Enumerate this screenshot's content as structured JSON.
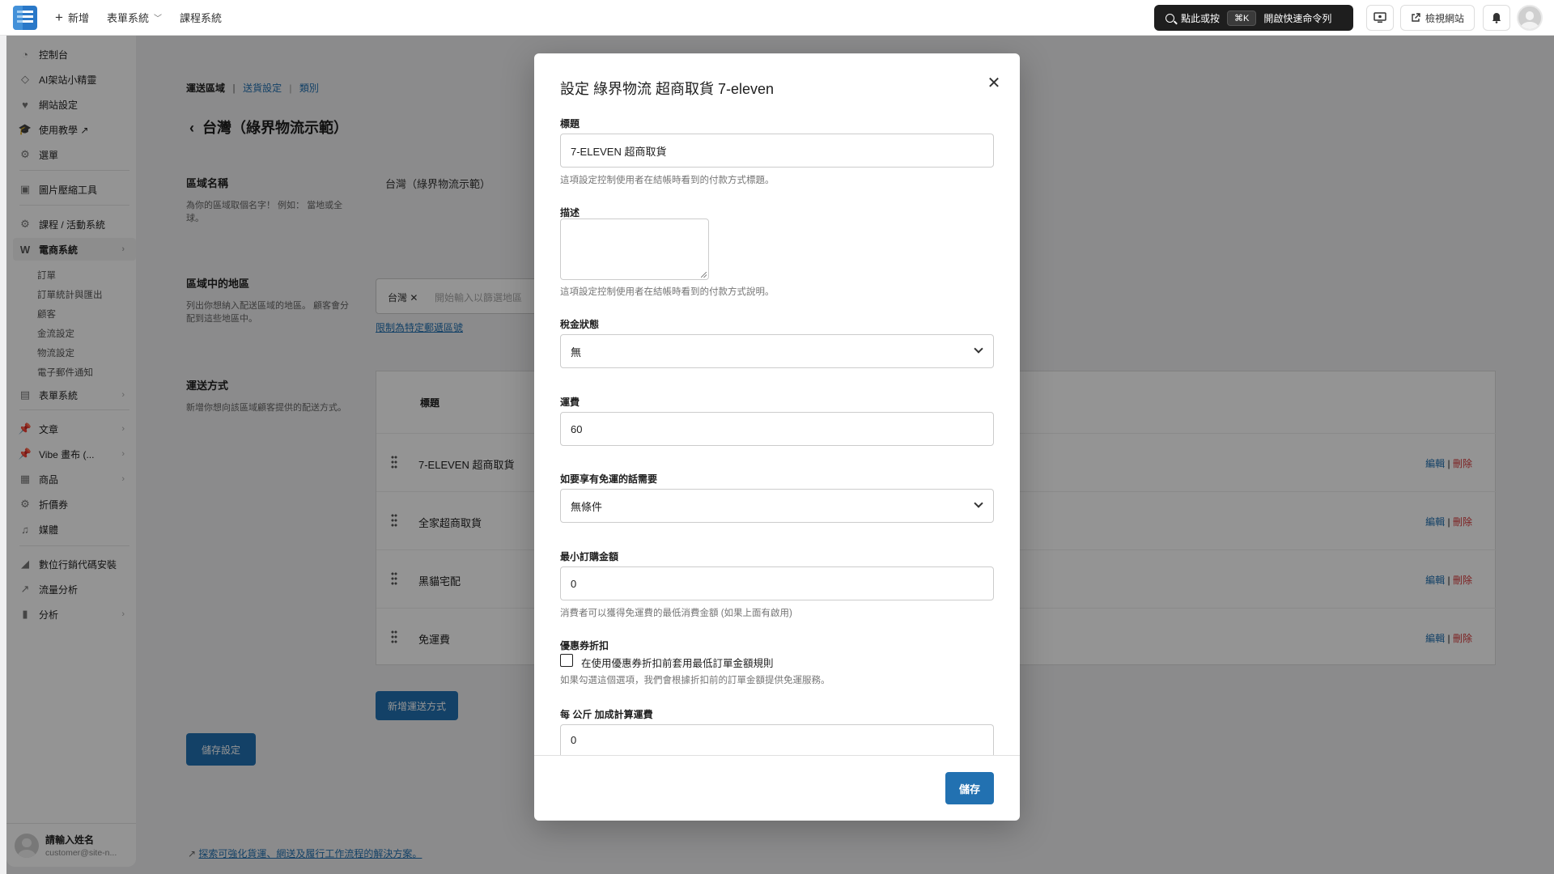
{
  "topbar": {
    "new_label": "新增",
    "forms_label": "表單系統",
    "courses_label": "課程系統",
    "command_left": "點此或按",
    "command_kbd": "⌘K",
    "command_right": "開啟快速命令列",
    "view_site": "檢視網站"
  },
  "sidebar": {
    "items": [
      {
        "label": "控制台",
        "icon": "dashboard-icon"
      },
      {
        "label": "AI架站小精靈",
        "icon": "ai-icon"
      },
      {
        "label": "網站設定",
        "icon": "heart-icon"
      },
      {
        "label": "使用教學 ↗",
        "icon": "graduation-icon"
      },
      {
        "label": "選單",
        "icon": "gear-icon"
      },
      {
        "label": "圖片壓縮工具",
        "icon": "image-icon"
      },
      {
        "label": "課程 / 活動系統",
        "icon": "gear-icon"
      },
      {
        "label": "電商系統",
        "icon": "woo-icon"
      },
      {
        "label": "表單系統",
        "icon": "form-icon"
      },
      {
        "label": "文章",
        "icon": "pin-icon"
      },
      {
        "label": "Vibe 畫布 (...",
        "icon": "pin-icon"
      },
      {
        "label": "商品",
        "icon": "box-icon"
      },
      {
        "label": "折價券",
        "icon": "gear-icon"
      },
      {
        "label": "媒體",
        "icon": "media-icon"
      },
      {
        "label": "數位行銷代碼安裝",
        "icon": "chart-icon"
      },
      {
        "label": "流量分析",
        "icon": "line-chart-icon"
      },
      {
        "label": "分析",
        "icon": "bar-chart-icon"
      }
    ],
    "sub_items": [
      "訂單",
      "訂單統計與匯出",
      "顧客",
      "金流設定",
      "物流設定",
      "電子郵件通知"
    ],
    "user_name": "請輸入姓名",
    "user_email": "customer@site-n..."
  },
  "main": {
    "breadcrumb": {
      "b1": "運送區域",
      "b2": "送貨設定",
      "b3": "類別",
      "sep": "|"
    },
    "page_title": "台灣（綠界物流示範）",
    "region_name_label": "區域名稱",
    "region_name_desc": "為你的區域取個名字！ 例如： 當地或全球。",
    "region_name_value": "台灣（綠界物流示範）",
    "regions_label": "區域中的地區",
    "regions_desc": "列出你想納入配送區域的地區。 顧客會分配到這些地區中。",
    "region_tag": "台灣",
    "regions_placeholder": "開始輸入以篩選地區",
    "limit_link": "限制為特定郵遞區號",
    "methods_label": "運送方式",
    "methods_desc": "新增你想向該區域顧客提供的配送方式。",
    "table_header": "標題",
    "rows": [
      {
        "title": "7-ELEVEN 超商取貨",
        "edit": "編輯",
        "sep": "|",
        "delete": "刪除"
      },
      {
        "title": "全家超商取貨",
        "edit": "編輯",
        "sep": "|",
        "delete": "刪除"
      },
      {
        "title": "黑貓宅配",
        "edit": "編輯",
        "sep": "|",
        "delete": "刪除"
      },
      {
        "title": "免運費",
        "edit": "編輯",
        "sep": "|",
        "delete": "刪除"
      }
    ],
    "add_method_button": "新增運送方式",
    "save_settings_button": "儲存設定",
    "footer_link": "探索可強化貨運、網送及履行工作流程的解決方案。"
  },
  "modal": {
    "title": "設定 綠界物流 超商取貨 7-eleven",
    "title_label": "標題",
    "title_value": "7-ELEVEN 超商取貨",
    "title_help": "這項設定控制使用者在結帳時看到的付款方式標題。",
    "desc_label": "描述",
    "desc_help": "這項設定控制使用者在結帳時看到的付款方式說明。",
    "tax_label": "稅金狀態",
    "tax_value": "無",
    "fee_label": "運費",
    "fee_value": "60",
    "free_label": "如要享有免運的話需要",
    "free_value": "無條件",
    "min_label": "最小訂購金額",
    "min_value": "0",
    "min_help": "消費者可以獲得免運費的最低消費金額 (如果上面有啟用)",
    "coupon_label": "優惠券折扣",
    "coupon_check_label": "在使用優惠券折扣前套用最低訂單金額規則",
    "coupon_help": "如果勾選這個選項，我們會根據折扣前的訂單金額提供免運服務。",
    "per_kg_label": "每 公斤 加成計算運費",
    "per_kg_value": "0",
    "save_button": "儲存"
  }
}
